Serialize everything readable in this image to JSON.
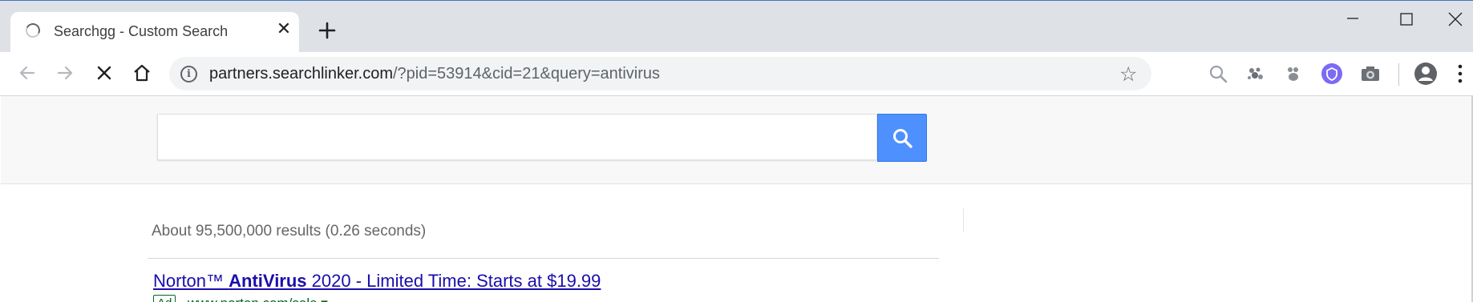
{
  "browser": {
    "tab": {
      "title": "Searchgg - Custom Search",
      "close_glyph": "✕"
    },
    "omnibox": {
      "url_host": "partners.searchlinker.com",
      "url_rest": "/?pid=53914&cid=21&query=antivirus",
      "info_glyph": "i",
      "star_glyph": "☆"
    },
    "extensions": [
      "zoom-search-icon",
      "puzzle-extension-icon",
      "pawprint-extension-icon",
      "shield-extension-icon",
      "camera-extension-icon"
    ],
    "accent_color": "#7b6bf4"
  },
  "page": {
    "search": {
      "value": "",
      "button_color": "#4d90fe"
    },
    "results_stats": "About 95,500,000 results (0.26 seconds)",
    "ad": {
      "title_prefix": "Norton™ ",
      "title_bold": "AntiVirus",
      "title_suffix": " 2020 - Limited Time: Starts at $19.99",
      "badge": "Ad",
      "display_url": "www.norton.com/sale ▾"
    }
  }
}
